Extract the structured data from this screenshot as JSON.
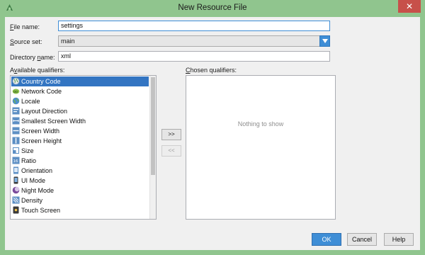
{
  "window": {
    "title": "New Resource File",
    "close_symbol": "✕",
    "app_icon": "android-studio-icon",
    "title_bar_color": "#90c58e"
  },
  "form": {
    "file_name": {
      "label_underlined": "F",
      "label_rest": "ile name:",
      "value": "settings"
    },
    "source_set": {
      "label_underlined": "S",
      "label_rest": "ource set:",
      "value": "main"
    },
    "directory_name": {
      "label_before": "Directory ",
      "label_underlined": "n",
      "label_rest": "ame:",
      "value": "xml"
    }
  },
  "available": {
    "label_before": "A",
    "label_underlined": "v",
    "label_rest": "ailable qualifiers:",
    "items": [
      {
        "label": "Country Code",
        "icon": "country-code-icon"
      },
      {
        "label": "Network Code",
        "icon": "network-code-icon"
      },
      {
        "label": "Locale",
        "icon": "locale-icon"
      },
      {
        "label": "Layout Direction",
        "icon": "layout-direction-icon"
      },
      {
        "label": "Smallest Screen Width",
        "icon": "smallest-screen-width-icon"
      },
      {
        "label": "Screen Width",
        "icon": "screen-width-icon"
      },
      {
        "label": "Screen Height",
        "icon": "screen-height-icon"
      },
      {
        "label": "Size",
        "icon": "size-icon"
      },
      {
        "label": "Ratio",
        "icon": "ratio-icon"
      },
      {
        "label": "Orientation",
        "icon": "orientation-icon"
      },
      {
        "label": "UI Mode",
        "icon": "ui-mode-icon"
      },
      {
        "label": "Night Mode",
        "icon": "night-mode-icon"
      },
      {
        "label": "Density",
        "icon": "density-icon"
      },
      {
        "label": "Touch Screen",
        "icon": "touch-screen-icon"
      }
    ],
    "selected_label": "Country Code"
  },
  "transfer": {
    "add_label": ">>",
    "remove_label": "<<"
  },
  "chosen": {
    "label_underlined": "C",
    "label_rest": "hosen qualifiers:",
    "empty_text": "Nothing to show"
  },
  "buttons": {
    "ok": "OK",
    "cancel": "Cancel",
    "help": "Help"
  },
  "colors": {
    "accent": "#3f8ed6",
    "selection": "#3375c2"
  }
}
